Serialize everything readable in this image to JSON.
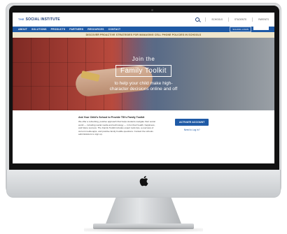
{
  "site": {
    "logo_prefix": "THE",
    "logo_name": "SOCIAL INSTITUTE"
  },
  "header": {
    "links": [
      "SCHOOLS",
      "STUDENTS",
      "PARENTS"
    ]
  },
  "nav": {
    "items": [
      "ABOUT",
      "SOLUTIONS",
      "PRODUCTS",
      "PARTNERS",
      "RESOURCES",
      "CONTACT"
    ],
    "login_label": "SCHOOL LOGIN"
  },
  "announcement": {
    "text": "DISCOVER PROACTIVE STRATEGIES FOR MANAGING CELL PHONE POLICIES IN SCHOOLS"
  },
  "hero": {
    "join": "Join the",
    "title": "Family Toolkit",
    "subtitle_line1": "to help your child make high-",
    "subtitle_line2": "character decisions online and off"
  },
  "lower": {
    "heading": "Ask Your Child's School to Provide TSI's Family Toolkit",
    "body": "We offer a refreshing, positive approach that helps students navigate their social world — including social media and technology — in fun their health, happiness, and future success. The Family Toolkit includes expert tools tips, a overview of current media apps, and positive family huddle questions. Contact the schools administrators to sign up.",
    "cta_label": "ACTIVATE ACCOUNT",
    "login_link": "Need to Log In?"
  },
  "colors": {
    "brand_blue": "#1f5aa6",
    "logo_blue": "#1c3d78",
    "announcement_bg": "#efe6cc"
  }
}
